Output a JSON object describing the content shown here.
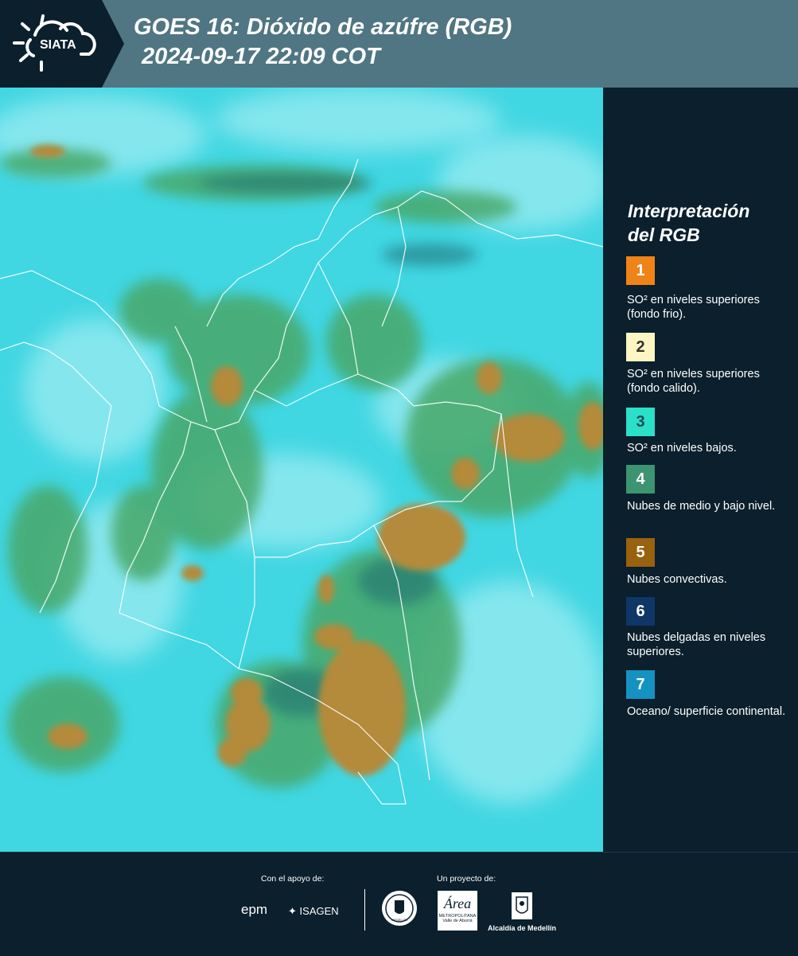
{
  "header": {
    "logo_text": "SIATA",
    "title_line1": "GOES 16: Dióxido de azúfre (RGB)",
    "title_line2": "2024-09-17 22:09 COT"
  },
  "legend": {
    "title_line1": "Interpretación",
    "title_line2": "del RGB",
    "items": [
      {
        "number": "1",
        "label": "SO² en niveles superiores (fondo frio).",
        "color": "#f08317",
        "text_color": "#ffffff"
      },
      {
        "number": "2",
        "label": "SO² en niveles superiores (fondo calido).",
        "color": "#fdf6c2",
        "text_color": "#333333"
      },
      {
        "number": "3",
        "label": "SO² en niveles bajos.",
        "color": "#2be0c9",
        "text_color": "#1b4b55"
      },
      {
        "number": "4",
        "label": "Nubes de medio y bajo nivel.",
        "color": "#3d9470",
        "text_color": "#ffffff"
      },
      {
        "number": "5",
        "label": "Nubes convectivas.",
        "color": "#99620f",
        "text_color": "#ffffff"
      },
      {
        "number": "6",
        "label": "Nubes delgadas en niveles superiores.",
        "color": "#0e3667",
        "text_color": "#ffffff"
      },
      {
        "number": "7",
        "label": "Oceano/ superficie continental.",
        "color": "#1592c2",
        "text_color": "#ffffff"
      }
    ]
  },
  "footer": {
    "support_label": "Con el apoyo de:",
    "project_label": "Un proyecto de:",
    "sponsor1": "epm",
    "sponsor2": "ISAGEN",
    "partner1_text": "MEDELLÍN",
    "partner2_logo": "Área",
    "partner2_text1": "METROPOLITANA",
    "partner2_text2": "Valle de Aburrá",
    "partner3_text": "Alcaldía de Medellín"
  },
  "map": {
    "ocean_color": "#40d6e2",
    "cloud_light_color": "#8ee8f0",
    "cloud_green_color": "#4ba768",
    "convective_color": "#b58a3c",
    "border_color": "#ffffff"
  }
}
